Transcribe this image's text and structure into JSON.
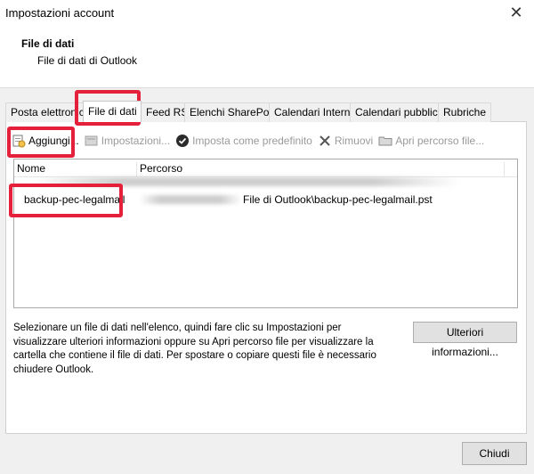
{
  "window": {
    "title": "Impostazioni account",
    "close_glyph": "✕"
  },
  "header": {
    "title": "File di dati",
    "subtitle": "File di dati di Outlook"
  },
  "tabs": [
    {
      "label": "Posta elettronica",
      "active": false
    },
    {
      "label": "File di dati",
      "active": true
    },
    {
      "label": "Feed RSS",
      "active": false
    },
    {
      "label": "Elenchi SharePoint",
      "active": false
    },
    {
      "label": "Calendari Internet",
      "active": false
    },
    {
      "label": "Calendari pubblicati",
      "active": false
    },
    {
      "label": "Rubriche",
      "active": false
    }
  ],
  "toolbar": {
    "add": {
      "label": "Aggiungi...",
      "icon": "add-data-file-icon"
    },
    "settings": {
      "label": "Impostazioni...",
      "icon": "settings-icon"
    },
    "set_default": {
      "label": "Imposta come predefinito",
      "icon": "checkmark-circle-icon"
    },
    "remove": {
      "label": "Rimuovi",
      "icon": "x-icon"
    },
    "open_location": {
      "label": "Apri percorso file...",
      "icon": "folder-icon"
    }
  },
  "table": {
    "columns": [
      "Nome",
      "Percorso"
    ],
    "rows": [
      {
        "name": "backup-pec-legalmail",
        "path": "File di Outlook\\backup-pec-legalmail.pst"
      }
    ]
  },
  "info_text": "Selezionare un file di dati nell'elenco, quindi fare clic su Impostazioni per visualizzare ulteriori informazioni oppure su Apri percorso file per visualizzare la cartella che contiene il file di dati. Per spostare o copiare questi file è necessario chiudere Outlook.",
  "buttons": {
    "more_info": "Ulteriori informazioni...",
    "close": "Chiudi"
  },
  "colors": {
    "highlight": "#e5203a"
  }
}
